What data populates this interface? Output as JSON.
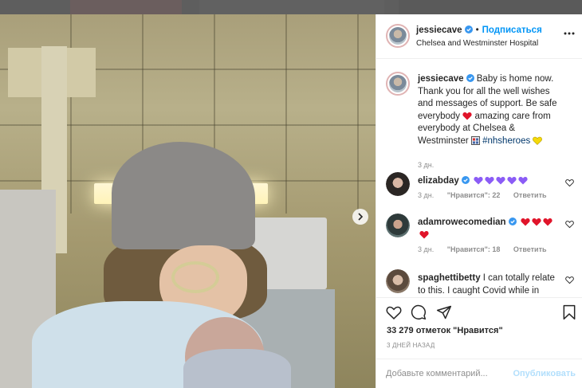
{
  "post": {
    "username": "jessiecave",
    "dot": "•",
    "follow_label": "Подписаться",
    "location": "Chelsea and Westminster Hospital",
    "more_icon": "more-horizontal-icon"
  },
  "caption": {
    "username": "jessiecave",
    "text_1": "Baby is home now. Thank you for all the well wishes and messages of support. Be safe everybody",
    "text_2": "amazing care from everybody at Chelsea & Westminster",
    "hashtag": "#nhsheroes",
    "time": "3 дн."
  },
  "comments": [
    {
      "username": "elizabday",
      "text": "",
      "time": "3 дн.",
      "likes": "\"Нравится\": 22",
      "reply": "Ответить",
      "emoji": [
        "purple-heart",
        "purple-heart",
        "purple-heart",
        "purple-heart",
        "purple-heart"
      ]
    },
    {
      "username": "adamrowecomedian",
      "text": "",
      "time": "3 дн.",
      "likes": "\"Нравится\": 18",
      "reply": "Ответить",
      "emoji": [
        "red-heart",
        "red-heart",
        "red-heart",
        "red-heart"
      ]
    },
    {
      "username": "spaghettibetty",
      "text": "I can totally relate to this. I caught Covid while in",
      "time": "",
      "likes": "",
      "reply": ""
    }
  ],
  "actions": {
    "likes_text": "33 279 отметок \"Нравится\"",
    "ago_text": "3 ДНЕЙ НАЗАД"
  },
  "add_comment": {
    "placeholder": "Добавьте комментарий...",
    "publish_label": "Опубликовать"
  },
  "colors": {
    "accent": "#0095f6",
    "publish_disabled": "#b2dffc",
    "meta": "#8e8e8e",
    "hashtag": "#00376b",
    "red_heart": "#e0142a",
    "purple_heart": "#8b5cf6",
    "yellow_heart": "#f5d90a"
  }
}
